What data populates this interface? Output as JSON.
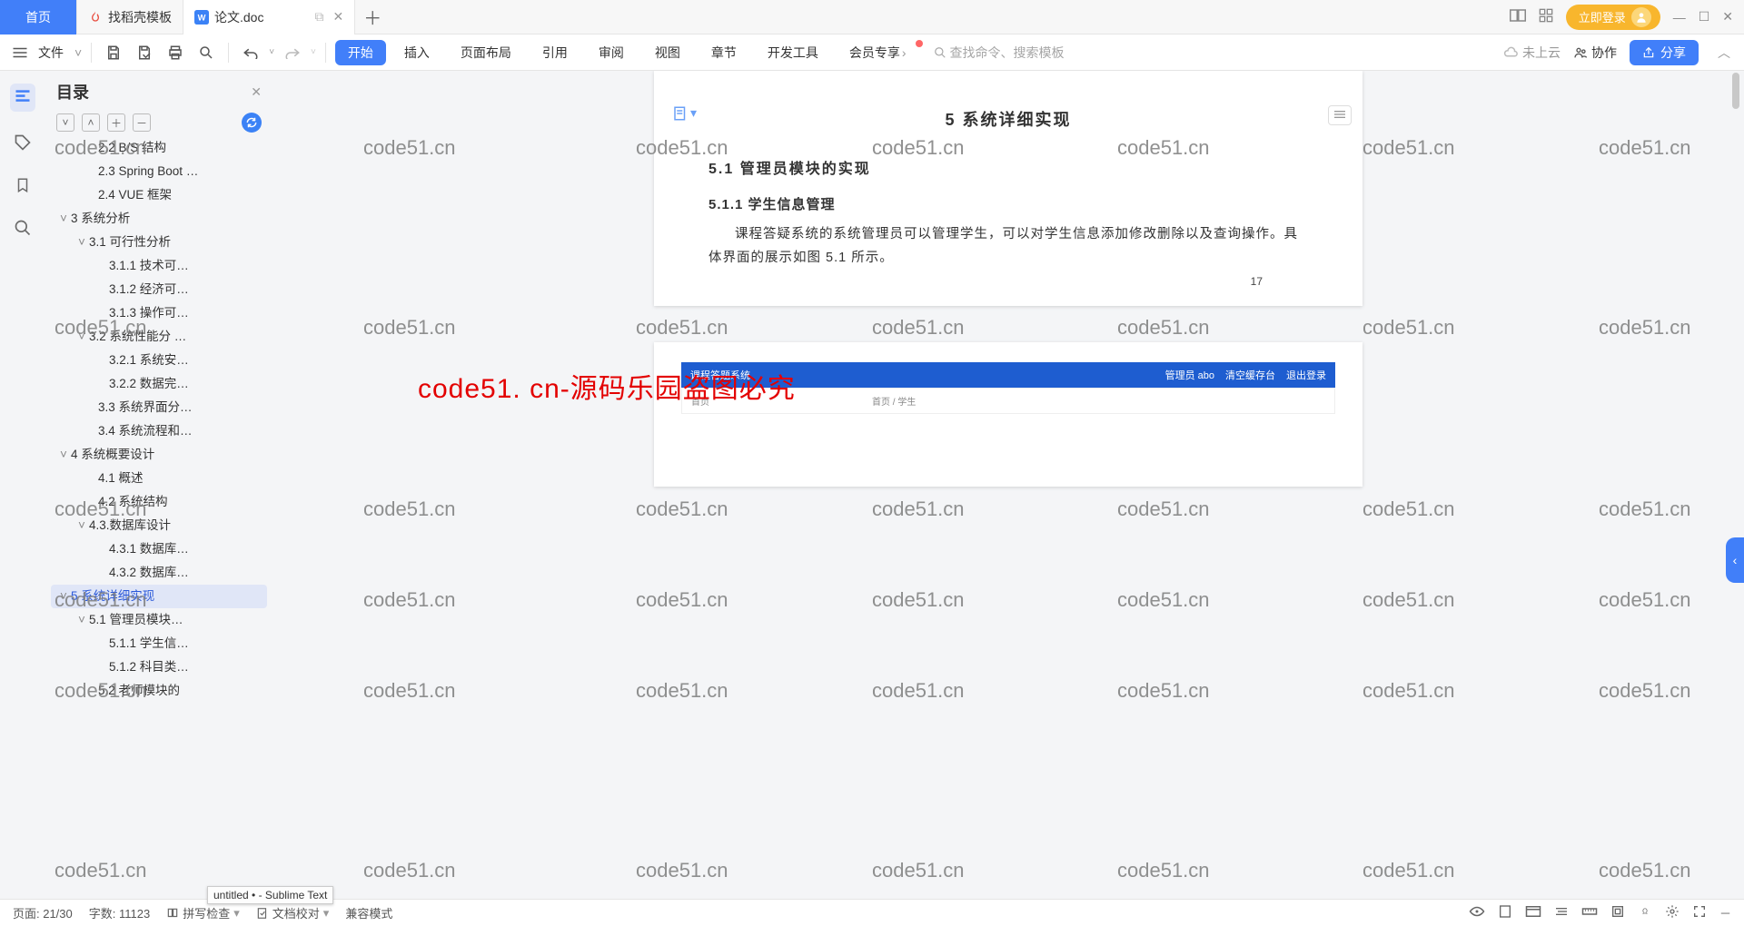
{
  "titlebar": {
    "home": "首页",
    "tabs": [
      {
        "label": "找稻壳模板",
        "active": false
      },
      {
        "label": "论文.doc",
        "active": true
      }
    ],
    "login": "立即登录"
  },
  "toolbar": {
    "file": "文件",
    "menu": [
      "开始",
      "插入",
      "页面布局",
      "引用",
      "审阅",
      "视图",
      "章节",
      "开发工具",
      "会员专享"
    ],
    "search_placeholder": "查找命令、搜索模板",
    "cloud": "未上云",
    "collab": "协作",
    "share": "分享"
  },
  "toc": {
    "title": "目录",
    "items": [
      {
        "lv": 2,
        "label": "2.2 B/S 结构"
      },
      {
        "lv": 2,
        "label": "2.3 Spring Boot …"
      },
      {
        "lv": 2,
        "label": "2.4 VUE 框架"
      },
      {
        "lv": 0,
        "chev": "˅",
        "label": "3 系统分析"
      },
      {
        "lv": 1,
        "chev": "˅",
        "label": "3.1 可行性分析"
      },
      {
        "lv": 3,
        "label": "3.1.1 技术可…"
      },
      {
        "lv": 3,
        "label": "3.1.2 经济可…"
      },
      {
        "lv": 3,
        "label": "3.1.3 操作可…"
      },
      {
        "lv": 1,
        "chev": "˅",
        "label": "3.2 系统性能分 …"
      },
      {
        "lv": 3,
        "label": "3.2.1  系统安…"
      },
      {
        "lv": 3,
        "label": "3.2.2  数据完…"
      },
      {
        "lv": 2,
        "label": "3.3 系统界面分…"
      },
      {
        "lv": 2,
        "label": "3.4 系统流程和…"
      },
      {
        "lv": 0,
        "chev": "˅",
        "label": "4 系统概要设计"
      },
      {
        "lv": 2,
        "label": "4.1  概述"
      },
      {
        "lv": 2,
        "label": "4.2  系统结构"
      },
      {
        "lv": 1,
        "chev": "˅",
        "label": "4.3.数据库设计"
      },
      {
        "lv": 3,
        "label": "4.3.1 数据库…"
      },
      {
        "lv": 3,
        "label": "4.3.2 数据库…"
      },
      {
        "lv": 0,
        "chev": "˅",
        "label": "5 系统详细实现",
        "sel": true
      },
      {
        "lv": 1,
        "chev": "˅",
        "label": "5.1  管理员模块…"
      },
      {
        "lv": 3,
        "label": "5.1.1  学生信…"
      },
      {
        "lv": 3,
        "label": "5.1.2  科目类…"
      },
      {
        "lv": 2,
        "label": "5.2  老师模块的"
      }
    ]
  },
  "doc": {
    "h1": "5 系统详细实现",
    "h2": "5.1  管理员模块的实现",
    "h3": "5.1.1  学生信息管理",
    "p": "课程答疑系统的系统管理员可以管理学生，可以对学生信息添加修改删除以及查询操作。具体界面的展示如图 5.1 所示。",
    "page_num": "17",
    "big_watermark": "code51. cn-源码乐园盗图必究",
    "page2": {
      "title": "课程答题系统",
      "user": "管理员 abo",
      "logout": "退出登录",
      "fresh": "清空缓存台",
      "home": "首页",
      "crumb": "首页 / 学生"
    }
  },
  "watermark": "code51.cn",
  "status": {
    "page": "页面: 21/30",
    "words": "字数: 11123",
    "spell": "拼写检查",
    "proof": "文档校对",
    "compat": "兼容模式"
  },
  "tooltip": "untitled • - Sublime Text"
}
